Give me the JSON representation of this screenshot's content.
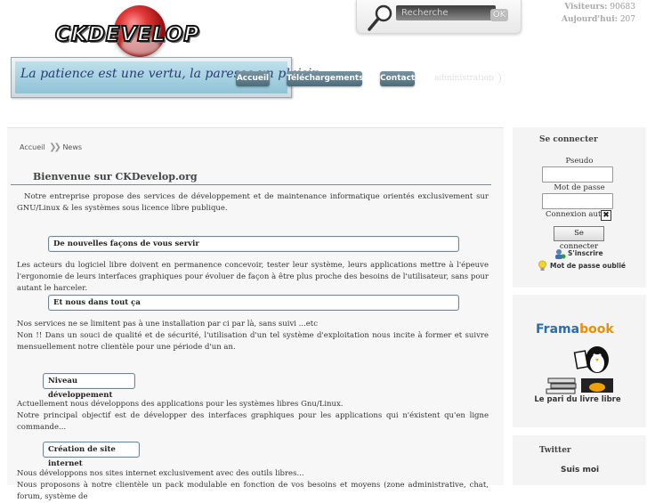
{
  "header": {
    "logo_text": "CKDEVELOP",
    "search": {
      "placeholder": "Recherche",
      "ok_label": "OK"
    },
    "visitors": {
      "visitors_label": "Visiteurs:",
      "visitors_value": "90683",
      "today_label": "Aujourd'hui:",
      "today_value": "207"
    },
    "slogan": "La patience est une vertu, la paresse un plaisir...",
    "nav": [
      "Accueil",
      "Téléchargements",
      "Contact",
      "administration"
    ]
  },
  "breadcrumb": {
    "home": "Accueil",
    "current": "News"
  },
  "main": {
    "title": "Bienvenue sur CKDevelop.org",
    "intro": "Notre entreprise propose des services de développement et de maintenance informatique orientés exclusivement sur GNU/Linux & les systèmes sous licence libre publique.",
    "sections": [
      {
        "heading": "De nouvelles façons de vous servir",
        "text": "Les acteurs du logiciel libre doivent en permanence concevoir, tester leur système, leurs applications mettre à l'épeuve l'ergonomie de leurs interfaces graphiques pour évoluer de façon à être plus proche des besoins de l'utilisateur, sans pour autant le harceler."
      },
      {
        "heading": "Et nous dans tout ça",
        "text1": "Nos services ne se limitent pas à une installation par ci par là, sans suivi ...etc",
        "text2": "Non !! Dans un souci de qualité et de sécurité, l'utilisation d'un tel système d'exploitation nous incite à former et suivre mensuellement notre clientèle pour une période d'un an."
      },
      {
        "heading": "Niveau développement",
        "text1": "Actuellement nous développons des applications pour les systèmes libres Gnu/Linux.",
        "text2": "Notre principal objectif est de développer des interfaces graphiques pour les applications qui n'éxistent qu'en ligne commande..."
      },
      {
        "heading": "Création de site internet",
        "text1": "Nous développons nos sites internet exclusivement avec des outils libres...",
        "text2": "Nous proposons à notre clientèle un pack modulable en fonction de vos besoins et moyens (zone administrative, chat, forum, système de"
      }
    ]
  },
  "sidebar": {
    "login": {
      "title": "Se connecter",
      "username_label": "Pseudo",
      "password_label": "Mot de passe",
      "autologin_label": "Connexion auto",
      "autologin_mark": "✖",
      "submit_label": "Se connecter",
      "register_label": "S'inscrire",
      "forgot_label": "Mot de passe oublié"
    },
    "framabook": {
      "brand_a": "Frama",
      "brand_b": "book",
      "tagline": "Le pari du livre libre"
    },
    "twitter": {
      "title": "Twitter",
      "subtitle": "Suis moi"
    }
  },
  "colors": {
    "nav_button": "#5a7987",
    "slogan_text": "#2a3c73",
    "framabook_blue": "#2a6db0",
    "framabook_orange": "#f08d00",
    "logo_orb": "#e23a3a"
  }
}
